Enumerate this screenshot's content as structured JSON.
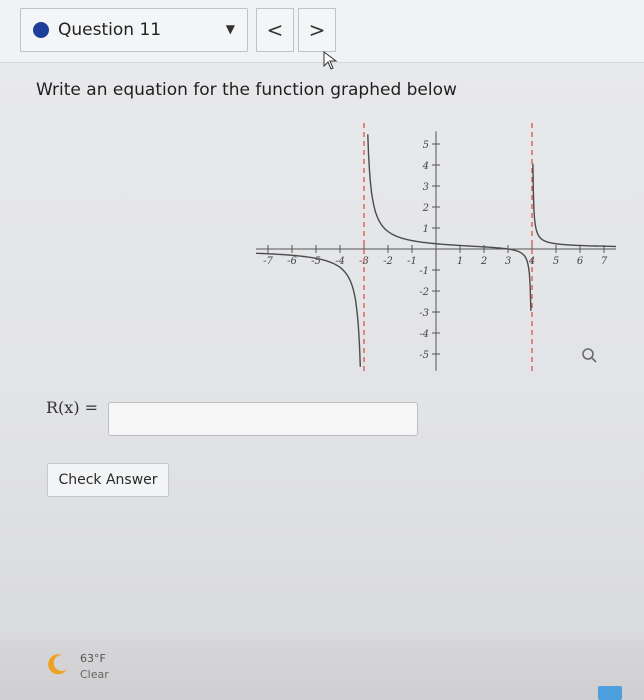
{
  "header": {
    "question_label": "Question 11",
    "prev_symbol": "<",
    "next_symbol": ">"
  },
  "prompt": "Write an equation for the function graphed below",
  "graph": {
    "x_ticks": [
      "-7",
      "-6",
      "-5",
      "-4",
      "-3",
      "-2",
      "-1",
      "1",
      "2",
      "3",
      "4",
      "5",
      "6",
      "7"
    ],
    "y_ticks": [
      "5",
      "4",
      "3",
      "2",
      "1",
      "-1",
      "-2",
      "-3",
      "-4",
      "-5"
    ],
    "vertical_asymptotes": [
      -3,
      4
    ],
    "x_intercept": 3
  },
  "answer": {
    "label": "R(x) =",
    "value": ""
  },
  "check_button": "Check Answer",
  "taskbar": {
    "temperature": "63°F",
    "condition": "Clear"
  },
  "colors": {
    "question_dot": "#1d3f9a",
    "asymptote": "#d9534f"
  }
}
